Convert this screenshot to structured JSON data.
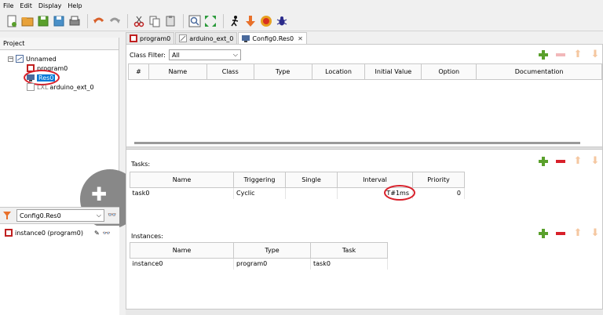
{
  "menu": [
    "File",
    "Edit",
    "Display",
    "Help"
  ],
  "project_panel": {
    "header": "Project",
    "tree": {
      "root": "Unnamed",
      "program": "program0",
      "resource": "Res0",
      "ext": "arduino_ext_0",
      "ext_prefix": "LXL"
    }
  },
  "config": {
    "selected": "Config0.Res0",
    "instances": [
      "instance0 (program0)"
    ]
  },
  "tabs": [
    {
      "label": "program0"
    },
    {
      "label": "arduino_ext_0"
    },
    {
      "label": "Config0.Res0",
      "close": "✕"
    }
  ],
  "filter": {
    "label": "Class Filter:",
    "value": "All"
  },
  "variables": {
    "columns": [
      "#",
      "Name",
      "Class",
      "Type",
      "Location",
      "Initial Value",
      "Option",
      "Documentation"
    ]
  },
  "tasks": {
    "label": "Tasks:",
    "columns": [
      "Name",
      "Triggering",
      "Single",
      "Interval",
      "Priority"
    ],
    "rows": [
      {
        "name": "task0",
        "triggering": "Cyclic",
        "single": "",
        "interval": "T#1ms",
        "priority": "0"
      }
    ]
  },
  "instances": {
    "label": "Instances:",
    "columns": [
      "Name",
      "Type",
      "Task"
    ],
    "rows": [
      {
        "name": "instance0",
        "type": "program0",
        "task": "task0"
      }
    ]
  },
  "colors": {
    "accent": "#0078d7",
    "highlight": "#d8202a",
    "add": "#5aa02c"
  }
}
